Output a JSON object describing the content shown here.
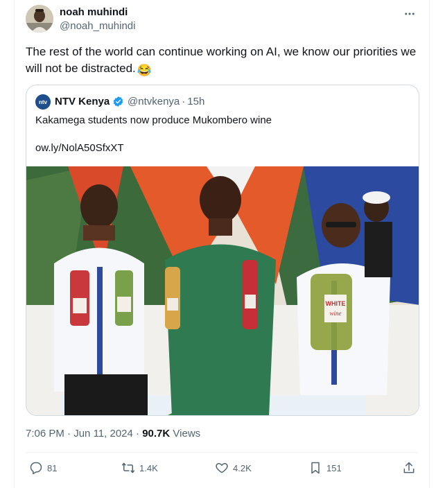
{
  "author": {
    "display_name": "noah muhindi",
    "handle": "@noah_muhindi"
  },
  "tweet": {
    "text": "The rest of the world can continue working on AI, we know our priorities we will not be distracted.",
    "emoji": "😂"
  },
  "quoted": {
    "display_name": "NTV Kenya",
    "avatar_text": "ntv",
    "handle": "@ntvkenya",
    "separator": "·",
    "time": "15h",
    "text": "Kakamega students now produce Mukombero wine",
    "link": "ow.ly/NolA50SfxXT",
    "photo_label": "WHITE",
    "photo_label_sub": "wine"
  },
  "meta": {
    "time": "7:06 PM",
    "separator1": "·",
    "date": "Jun 11, 2024",
    "separator2": "·",
    "views_count": "90.7K",
    "views_label": "Views"
  },
  "actions": {
    "replies": "81",
    "reposts": "1.4K",
    "likes": "4.2K",
    "bookmarks": "151"
  },
  "colors": {
    "accent": "#1d9bf0",
    "text_primary": "#0f1419",
    "text_secondary": "#536471",
    "border": "#cfd9de"
  }
}
